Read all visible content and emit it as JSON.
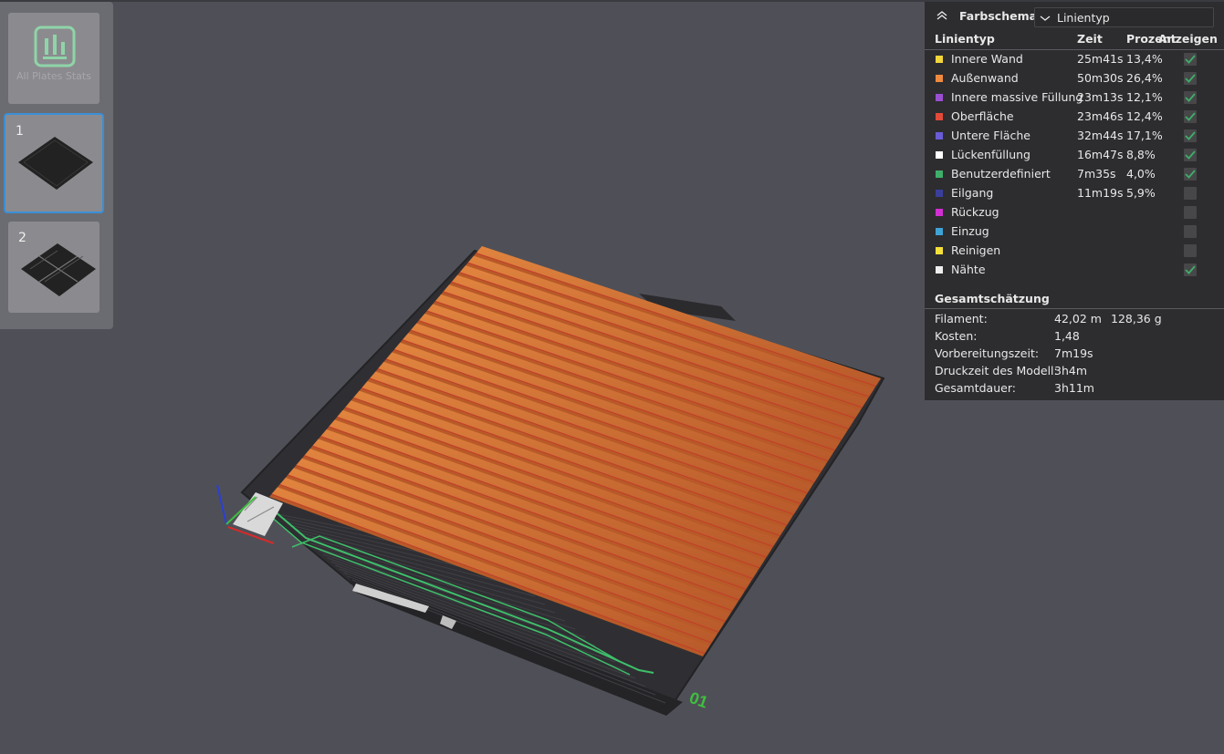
{
  "plates": {
    "all_stats_label": "All Plates Stats",
    "items": [
      {
        "number": "1"
      },
      {
        "number": "2"
      }
    ]
  },
  "legend": {
    "scheme_label": "Farbschema",
    "scheme_value": "Linientyp",
    "headers": {
      "type": "Linientyp",
      "time": "Zeit",
      "percent": "Prozent",
      "show": "Anzeigen"
    },
    "rows": [
      {
        "name": "Innere Wand",
        "time": "25m41s",
        "percent": "13,4%",
        "color": "#f5d63a",
        "checked": true
      },
      {
        "name": "Außenwand",
        "time": "50m30s",
        "percent": "26,4%",
        "color": "#f08a3e",
        "checked": true
      },
      {
        "name": "Innere massive Füllung",
        "time": "23m13s",
        "percent": "12,1%",
        "color": "#9b4fd0",
        "checked": true
      },
      {
        "name": "Oberfläche",
        "time": "23m46s",
        "percent": "12,4%",
        "color": "#e24a3a",
        "checked": true
      },
      {
        "name": "Untere Fläche",
        "time": "32m44s",
        "percent": "17,1%",
        "color": "#6a5cd6",
        "checked": true
      },
      {
        "name": "Lückenfüllung",
        "time": "16m47s",
        "percent": "8,8%",
        "color": "#ffffff",
        "checked": true
      },
      {
        "name": "Benutzerdefiniert",
        "time": "7m35s",
        "percent": "4,0%",
        "color": "#3fae6a",
        "checked": true
      },
      {
        "name": "Eilgang",
        "time": "11m19s",
        "percent": "5,9%",
        "color": "#3a3f9c",
        "checked": false
      },
      {
        "name": "Rückzug",
        "time": "",
        "percent": "",
        "color": "#d22fd2",
        "checked": false
      },
      {
        "name": "Einzug",
        "time": "",
        "percent": "",
        "color": "#3fa3d6",
        "checked": false
      },
      {
        "name": "Reinigen",
        "time": "",
        "percent": "",
        "color": "#f5e03a",
        "checked": false
      },
      {
        "name": "Nähte",
        "time": "",
        "percent": "",
        "color": "#eeeeee",
        "checked": true
      }
    ],
    "total_title": "Gesamtschätzung",
    "totals": [
      {
        "label": "Filament:",
        "value": "42,02 m",
        "value2": "128,36 g"
      },
      {
        "label": "Kosten:",
        "value": "1,48",
        "value2": ""
      },
      {
        "label": "Vorbereitungszeit:",
        "value": "7m19s",
        "value2": ""
      },
      {
        "label": "Druckzeit des Modell:",
        "value": "3h4m",
        "value2": ""
      },
      {
        "label": "Gesamtdauer:",
        "value": "3h11m",
        "value2": ""
      }
    ]
  },
  "bed": {
    "plate_label": "01"
  },
  "colors": {
    "accent": "#3a8fd6",
    "check": "#3fae6a",
    "model": "#d97a3a"
  }
}
